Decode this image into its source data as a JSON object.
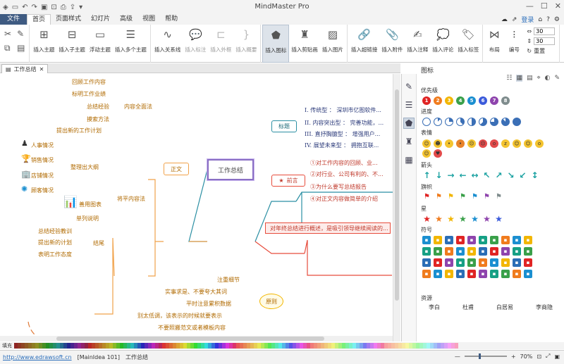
{
  "app": {
    "title": "MindMaster Pro"
  },
  "quickaccess": [
    "new-icon",
    "undo-icon",
    "redo-icon",
    "save-icon",
    "open-icon",
    "print-icon",
    "export-icon",
    "more-icon"
  ],
  "menu": {
    "file": "文件",
    "tabs": [
      "首页",
      "页面样式",
      "幻灯片",
      "高级",
      "视图",
      "帮助"
    ]
  },
  "topright": {
    "login": "登录"
  },
  "ribbon": {
    "insert_topic": "插入主题",
    "insert_subtopic": "插入子主题",
    "floating_topic": "浮动主题",
    "insert_multiple": "插入多个主题",
    "insert_relation": "插入关系线",
    "insert_label": "插入标注",
    "insert_outline": "插入外框",
    "insert_summary": "插入概要",
    "insert_icon": "插入图标",
    "insert_clipart": "插入剪贴画",
    "insert_image": "插入图片",
    "insert_hyperlink": "插入超链接",
    "insert_attachment": "插入附件",
    "insert_note": "插入注释",
    "insert_comment": "插入评论",
    "insert_tag": "插入标签",
    "layout": "布局",
    "numbering": "编号",
    "spin1": "30",
    "spin2": "30",
    "reset": "重置"
  },
  "doc": {
    "tab": "工作总结"
  },
  "mindmap": {
    "center": "工作总结",
    "main_left": "正文",
    "title_node": "标题",
    "preface": "前言",
    "title_items": [
      "I. 传统型 ： 深圳市亿图软件...",
      "II. 内容突出型 ： 完善功能，...",
      "III. 直抒胸臆型 ： 增强用户...",
      "IV. 展望未来型 ： 拥抱互联..."
    ],
    "preface_items": [
      "①对工作内容的回顾、业...",
      "②对行业、公司有利的、不...",
      "③为什么要写总结报告",
      "④对正文内容做简单的介绍"
    ],
    "callout": "对年终总结进行概述，是吸引领导继续阅读的...",
    "upper_group": [
      "回顾工作内容",
      "标明工作业绩",
      "总结经验",
      "摸索方法",
      "提出新的工作计划"
    ],
    "upper_label": "内容全面法",
    "people_items": [
      "人事情况",
      "销售情况",
      "店铺情况",
      "顾客情况"
    ],
    "people_label": "整理出大纲",
    "chart_label": "善用图表",
    "simple": "单列说明",
    "flat_label": "将平内容法",
    "summary_items": [
      "总结经验教训",
      "提出新的计划",
      "表明工作态度"
    ],
    "summary_label": "结尾",
    "principle": "原则",
    "principle_items": [
      "注重细节",
      "实事求是、不要夸大其词",
      "平时注意累积数据",
      "别太低调，该表示的时候就要表示",
      "不要照搬范文或者模板内容"
    ]
  },
  "panel": {
    "title": "图标",
    "priority": "优先级",
    "priority_items": [
      "1",
      "2",
      "3",
      "4",
      "5",
      "6",
      "7",
      "8"
    ],
    "priority_colors": [
      "#e02424",
      "#f07c1e",
      "#f2b600",
      "#3aa04a",
      "#1b8fd0",
      "#3b5bdb",
      "#8e44ad",
      "#7f8c8d"
    ],
    "progress": "进度",
    "expression": "表情",
    "arrow": "箭头",
    "flag": "旗帜",
    "star": "星",
    "symbol": "符号",
    "resource": "资源",
    "resources": [
      "李白",
      "杜甫",
      "白居易",
      "李商隐"
    ]
  },
  "colorbar": {
    "label": "填充"
  },
  "status": {
    "url": "http://www.edrawsoft.cn",
    "doc": "[MainIdea 101]",
    "page": "工作总结",
    "zoom": "70%"
  }
}
